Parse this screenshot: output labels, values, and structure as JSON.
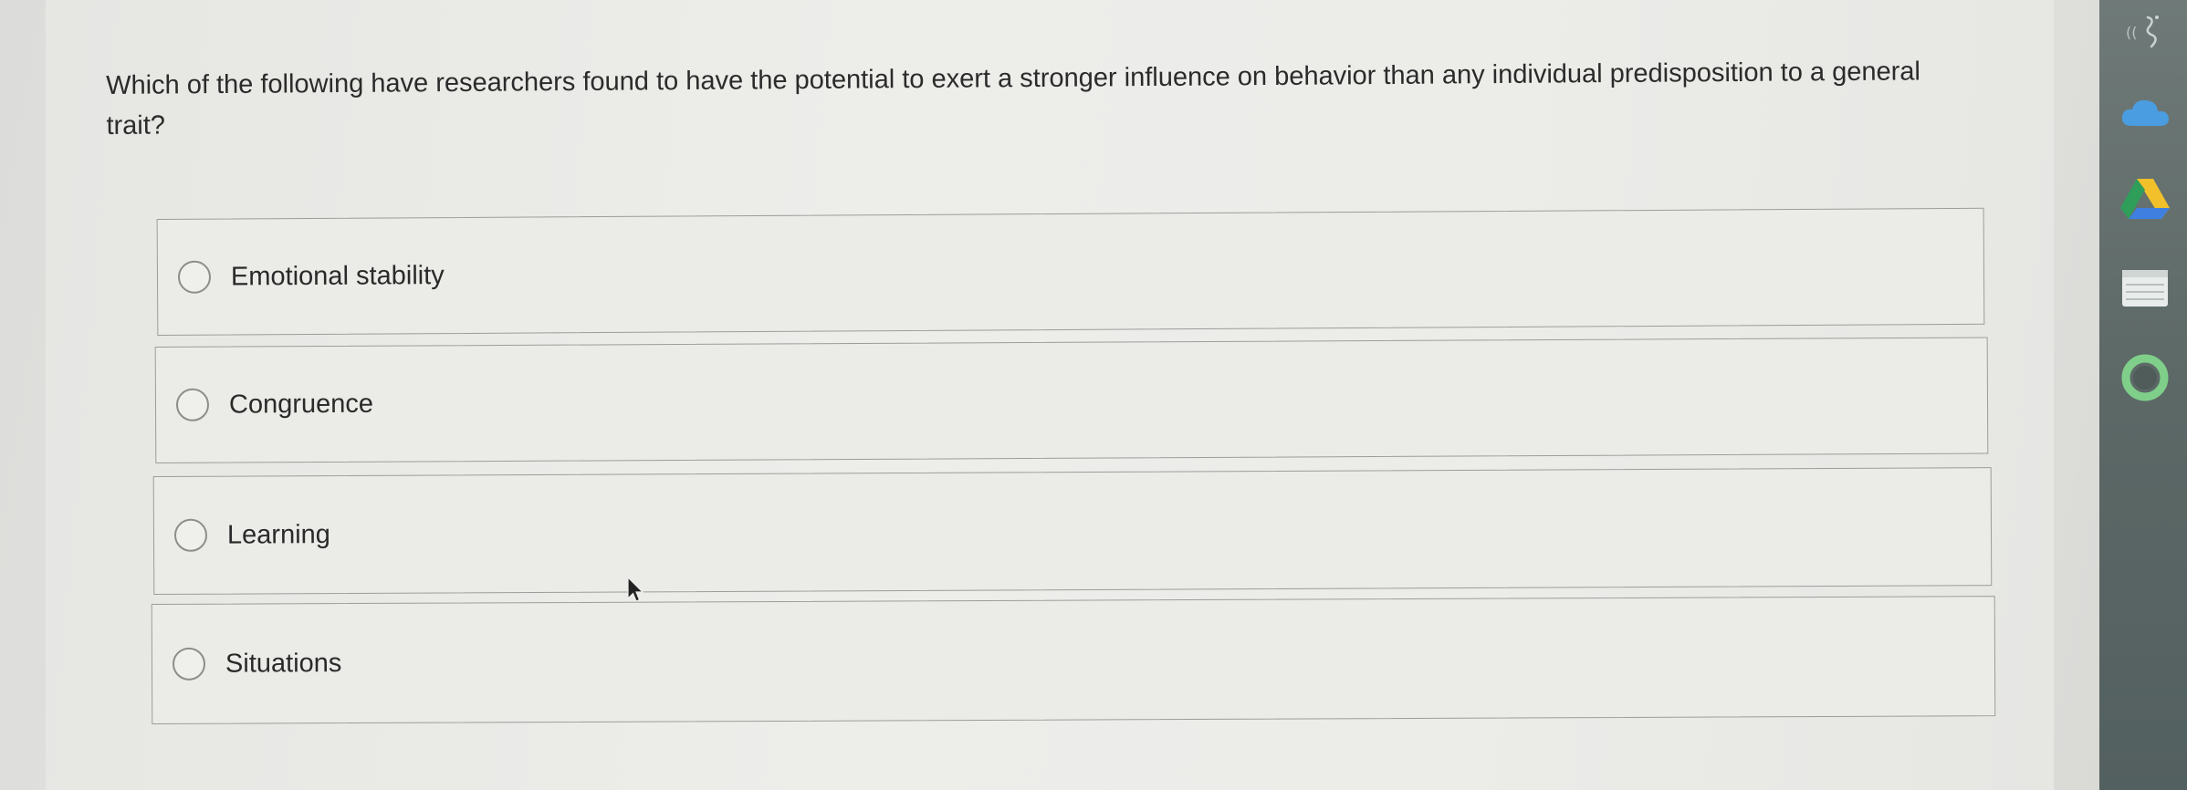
{
  "question": {
    "text": "Which of the following have researchers found to have the potential to exert a stronger influence on behavior than any individual predisposition to a general trait?"
  },
  "options": [
    {
      "label": "Emotional stability"
    },
    {
      "label": "Congruence"
    },
    {
      "label": "Learning"
    },
    {
      "label": "Situations"
    }
  ],
  "sidebar": {
    "icons": [
      "accessibility-icon",
      "cloud-icon",
      "drive-icon",
      "notes-icon",
      "circle-app-icon"
    ]
  },
  "colors": {
    "sidebar_bg": "#5c6866",
    "cloud_blue": "#4a9de0",
    "drive_green": "#2e9e5a",
    "drive_yellow": "#f2c02b",
    "drive_blue": "#3f7fe0",
    "ring_green": "#7fcf8a"
  }
}
